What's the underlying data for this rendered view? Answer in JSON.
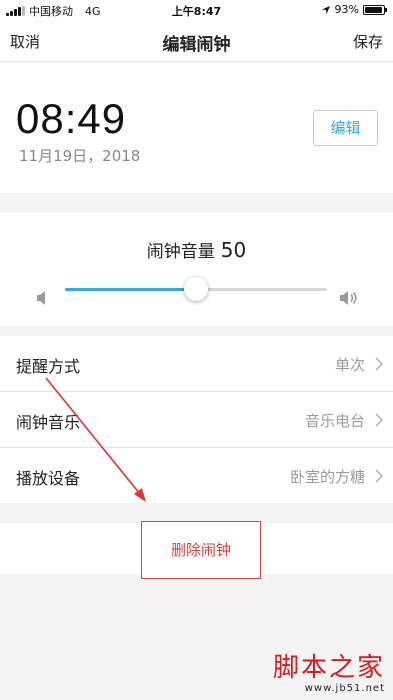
{
  "status_bar": {
    "carrier": "中国移动",
    "network": "4G",
    "time": "上午8:47",
    "battery": "93%",
    "battery_level": 0.93
  },
  "nav": {
    "cancel": "取消",
    "title": "编辑闹钟",
    "save": "保存"
  },
  "alarm": {
    "time": "08:49",
    "date": "11月19日，2018",
    "edit_label": "编辑"
  },
  "volume": {
    "label": "闹钟音量",
    "value": "50",
    "level": 50,
    "max": 100,
    "accent_color": "#35a9e0"
  },
  "settings": {
    "items": [
      {
        "label": "提醒方式",
        "value": "单次"
      },
      {
        "label": "闹钟音乐",
        "value": "音乐电台"
      },
      {
        "label": "播放设备",
        "value": "卧室的方糖"
      }
    ]
  },
  "delete": {
    "label": "删除闹钟",
    "color": "#e0403a"
  },
  "watermark": {
    "text": "脚本之家",
    "url": "www.jb51.net"
  }
}
